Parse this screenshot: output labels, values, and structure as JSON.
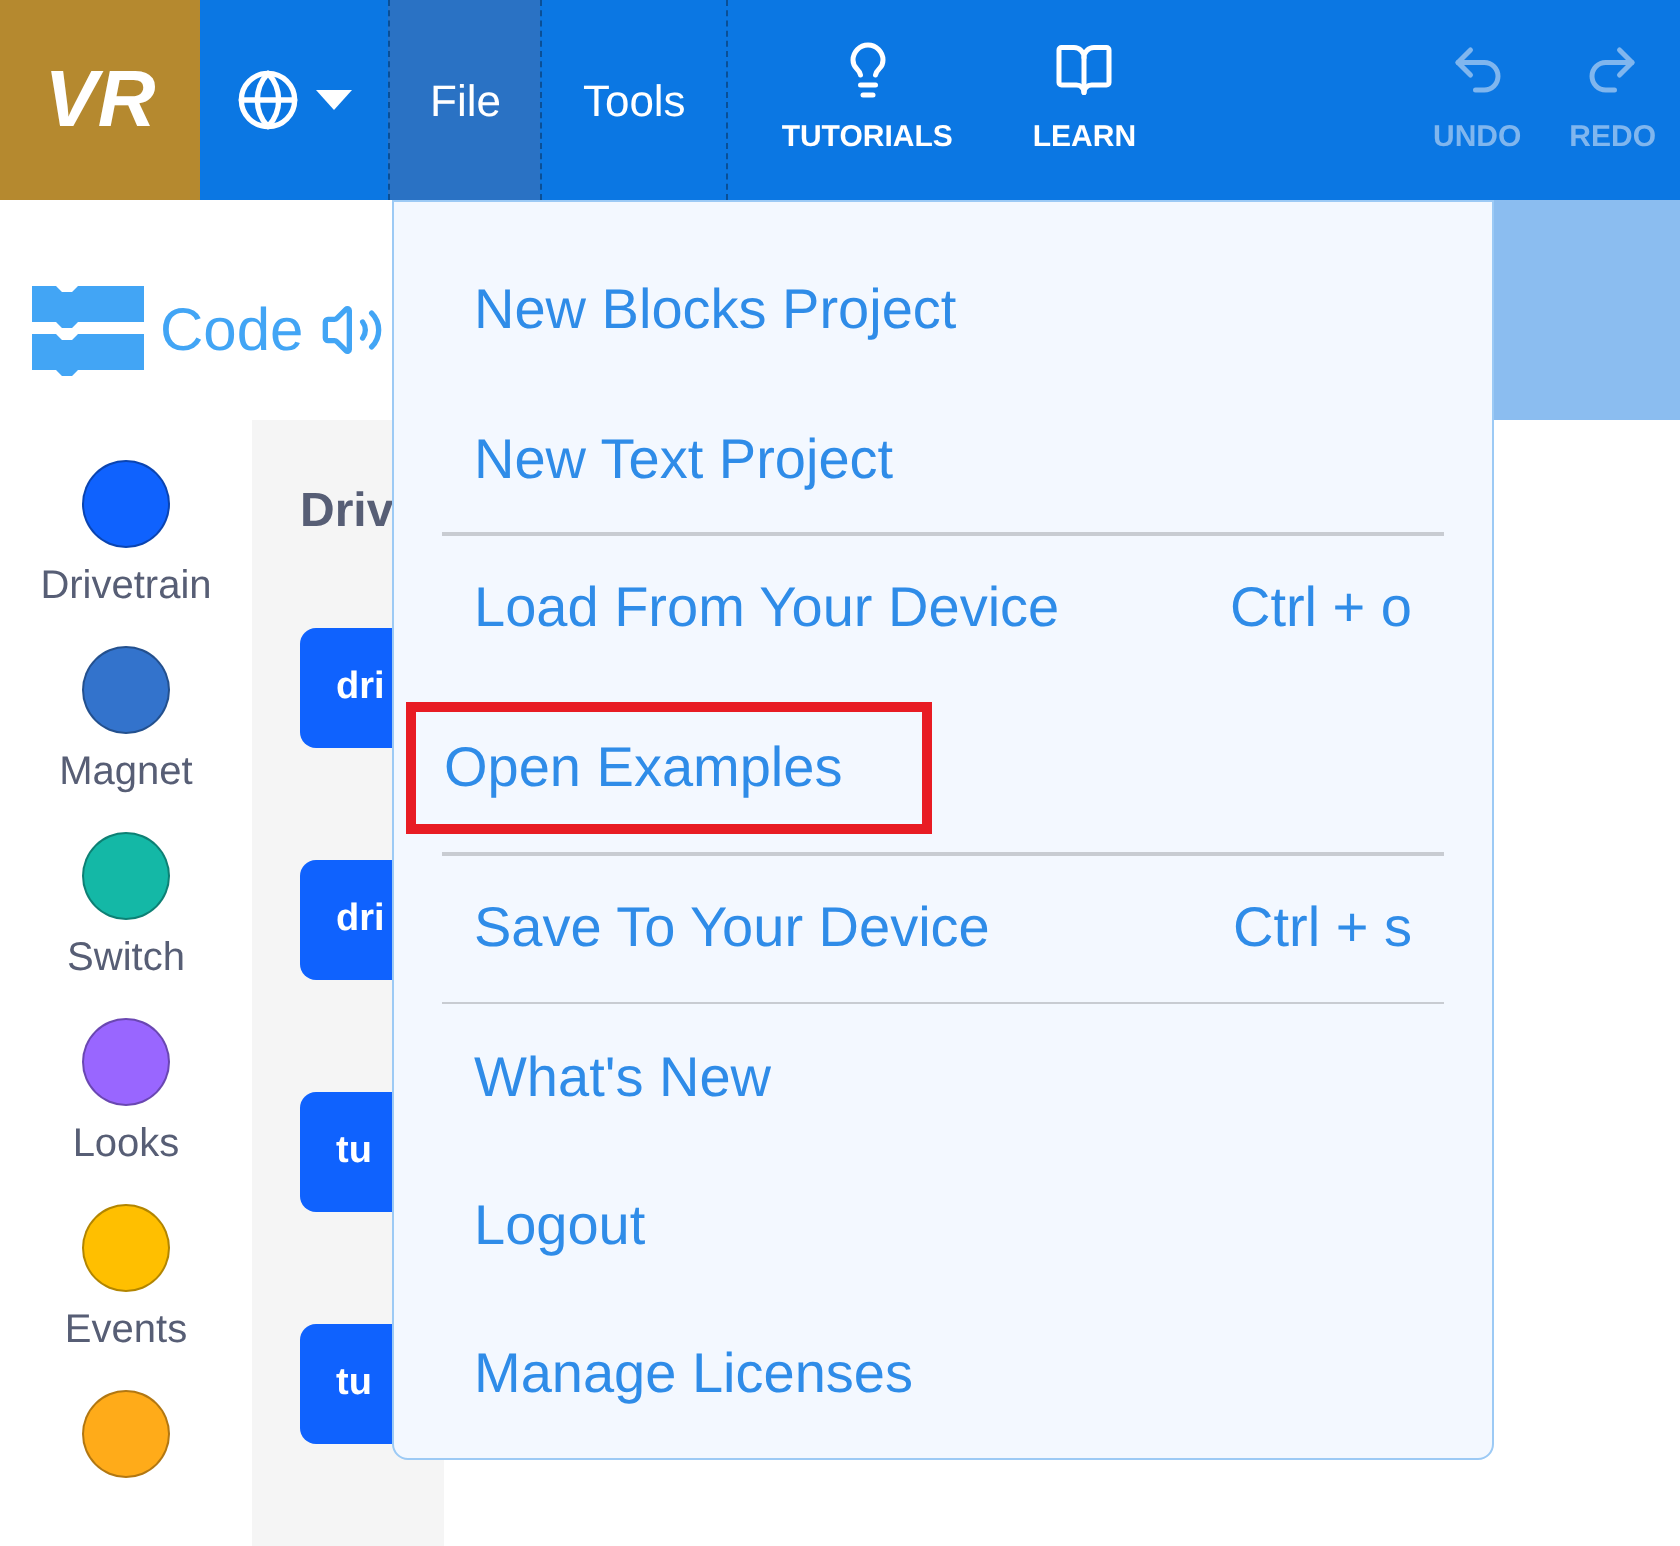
{
  "logo": {
    "text": "VR"
  },
  "toolbar": {
    "menus": [
      {
        "label": "File",
        "selected": true
      },
      {
        "label": "Tools",
        "selected": false
      }
    ],
    "actions": [
      {
        "label": "TUTORIALS",
        "kind": "bulb",
        "disabled": false
      },
      {
        "label": "LEARN",
        "kind": "book",
        "disabled": false
      },
      {
        "label": "UNDO",
        "kind": "undo",
        "disabled": true
      },
      {
        "label": "REDO",
        "kind": "redo",
        "disabled": true
      }
    ]
  },
  "panel_tab": {
    "label": "Code"
  },
  "categories": [
    {
      "label": "Drivetrain",
      "color": "#0f62fe"
    },
    {
      "label": "Magnet",
      "color": "#3373cc"
    },
    {
      "label": "Switch",
      "color": "#14b8a6"
    },
    {
      "label": "Looks",
      "color": "#9966ff"
    },
    {
      "label": "Events",
      "color": "#ffbf00"
    },
    {
      "color": "#ffab19"
    }
  ],
  "palette": {
    "heading": "Driv",
    "blocks": [
      {
        "text": "dri"
      },
      {
        "text": "dri"
      },
      {
        "text": "tu"
      },
      {
        "text": "tu"
      }
    ]
  },
  "file_menu": {
    "items": [
      {
        "label": "New Blocks Project",
        "highlighted": false,
        "divider_after": false
      },
      {
        "label": "New Text Project",
        "highlighted": false,
        "divider_after": true
      },
      {
        "label": "Load From Your Device",
        "shortcut": "Ctrl + o",
        "highlighted": false,
        "divider_after": false
      },
      {
        "label": "Open Examples",
        "highlighted": true,
        "divider_after": true
      },
      {
        "label": "Save To Your Device",
        "shortcut": "Ctrl + s",
        "highlighted": false,
        "divider_after": true
      },
      {
        "label": "What's New",
        "highlighted": false,
        "divider_after": false
      },
      {
        "label": "Logout",
        "highlighted": false,
        "divider_after": false
      },
      {
        "label": "Manage Licenses",
        "highlighted": false,
        "divider_after": false
      }
    ]
  }
}
